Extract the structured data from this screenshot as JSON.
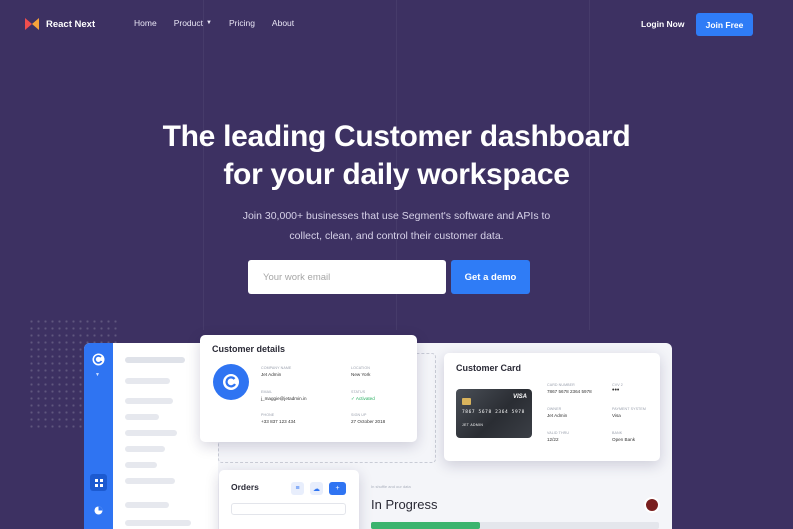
{
  "nav": {
    "brand": "React Next",
    "links": [
      "Home",
      "Product",
      "Pricing",
      "About"
    ],
    "login": "Login Now",
    "join": "Join Free"
  },
  "hero": {
    "title_line1": "The leading Customer dashboard",
    "title_line2": "for your daily workspace",
    "sub_line1": "Join 30,000+ businesses that use Segment's software and APIs to",
    "sub_line2": "collect, clean, and control their customer data.",
    "email_placeholder": "Your work email",
    "cta": "Get a demo"
  },
  "customer_details": {
    "title": "Customer details",
    "company_label": "COMPANY NAME",
    "company": "Jet Admin",
    "location_label": "LOCATION",
    "location": "New York",
    "email_label": "EMAIL",
    "email": "j_maggie@jetadmin.in",
    "status_label": "STATUS",
    "status": "✓ Activated",
    "phone_label": "PHONE",
    "phone": "+33 837 123 434",
    "signup_label": "SIGN UP",
    "signup": "27 October 2018"
  },
  "customer_card": {
    "title": "Customer Card",
    "visa_logo": "VISA",
    "visa_number": "7867 5678 2364 5978",
    "visa_name": "JET ADMIN",
    "number_label": "CARD NUMBER",
    "number": "7867 5678 2364 5978",
    "cvv_label": "CVV 2",
    "cvv": "•••",
    "owner_label": "OWNER",
    "owner": "Jet Admin",
    "payment_label": "PAYMENT SYSTEM",
    "payment": "Visa",
    "valid_label": "VALID THRU",
    "valid": "12/22",
    "bank_label": "BANK",
    "bank": "Open Bank"
  },
  "orders": {
    "title": "Orders",
    "add": "+"
  },
  "progress": {
    "crumb": "In shuffle and our data",
    "title": "In Progress",
    "fraction": 0.38
  },
  "colors": {
    "bg": "#3d3162",
    "accent": "#2f7cf6",
    "green": "#3bb46e"
  }
}
